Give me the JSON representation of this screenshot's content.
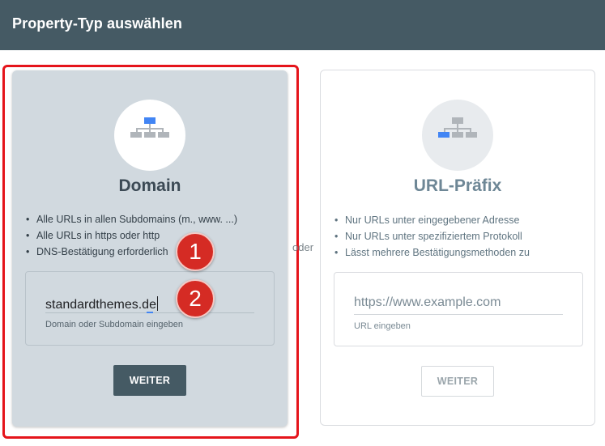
{
  "header": {
    "title": "Property-Typ auswählen"
  },
  "domain_card": {
    "icon": "sitemap-icon",
    "title": "Domain",
    "bullets": [
      "Alle URLs in allen Subdomains (m., www. ...)",
      "Alle URLs in https oder http",
      "DNS-Bestätigung erforderlich"
    ],
    "input_value": "standardthemes.de",
    "input_hint": "Domain oder Subdomain eingeben",
    "button_label": "WEITER"
  },
  "separator": {
    "label": "oder"
  },
  "url_card": {
    "icon": "sitemap-icon",
    "title": "URL-Präfix",
    "bullets": [
      "Nur URLs unter eingegebener Adresse",
      "Nur URLs unter spezifiziertem Protokoll",
      "Lässt mehrere Bestätigungsmethoden zu"
    ],
    "input_placeholder": "https://www.example.com",
    "input_hint": "URL eingeben",
    "button_label": "WEITER"
  },
  "annotations": {
    "step1": "1",
    "step2": "2"
  },
  "colors": {
    "header": "#455a64",
    "highlight": "#e5141b",
    "badge": "#d52b24",
    "accent_blue": "#4285f4"
  }
}
